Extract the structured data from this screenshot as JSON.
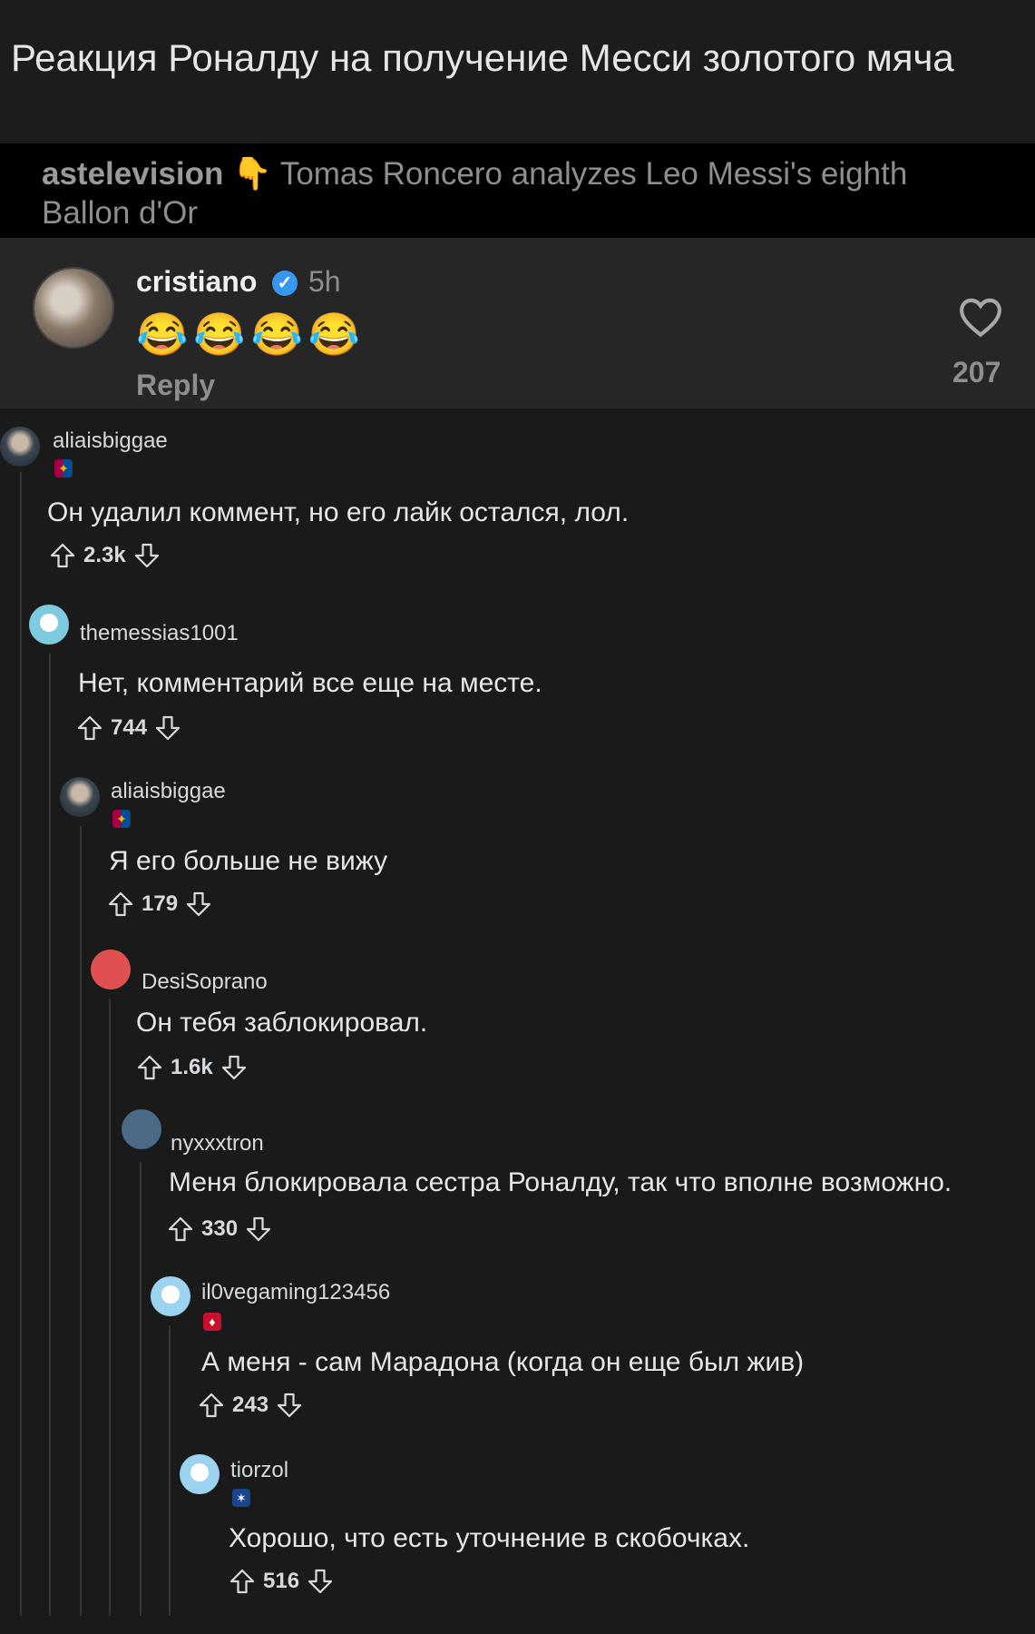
{
  "post": {
    "title": "Реакция Роналду на получение Месси золотого мяча"
  },
  "instagram": {
    "caption_user": "astelevision",
    "caption_emoji": "👇",
    "caption_text": "Tomas Roncero analyzes Leo Messi's eighth Ballon d'Or",
    "comment_user": "cristiano",
    "verified_icon": "verified-check-icon",
    "comment_time": "5h",
    "comment_text": "😂😂😂😂",
    "reply_label": "Reply",
    "like_icon": "heart-icon",
    "like_count": "207"
  },
  "comments": [
    {
      "user": "aliaisbiggae",
      "flair": "barcelona-crest-icon",
      "text": "Он удалил коммент, но его лайк остался, лол.",
      "score": "2.3k"
    },
    {
      "user": "themessias1001",
      "flair": "",
      "text": "Нет, комментарий все еще на месте.",
      "score": "744"
    },
    {
      "user": "aliaisbiggae",
      "flair": "barcelona-crest-icon",
      "text": "Я его больше не вижу",
      "score": "179"
    },
    {
      "user": "DesiSoprano",
      "flair": "",
      "text": "Он тебя заблокировал.",
      "score": "1.6k"
    },
    {
      "user": "nyxxxtron",
      "flair": "",
      "text": "Меня блокировала сестра Роналду, так что вполне возможно.",
      "score": "330"
    },
    {
      "user": "il0vegaming123456",
      "flair": "liverpool-crest-icon",
      "text": "А меня - сам Марадона (когда он еще был жив)",
      "score": "243"
    },
    {
      "user": "tiorzol",
      "flair": "crystal-palace-crest-icon",
      "text": "Хорошо, что есть уточнение в скобочках.",
      "score": "516"
    }
  ],
  "colors": {
    "background": "#1a1a1b",
    "instagram_panel": "#262626",
    "verified_blue": "#3897f0"
  }
}
